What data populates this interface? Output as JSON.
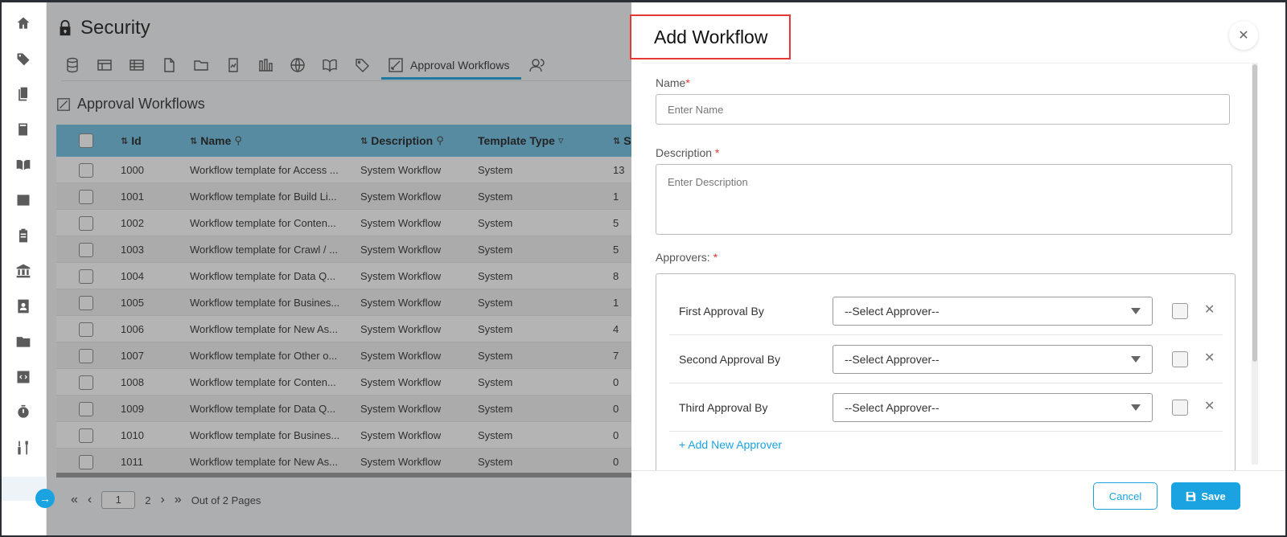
{
  "page": {
    "title": "Security"
  },
  "tabs": [
    {
      "icon": "database-icon",
      "label": ""
    },
    {
      "icon": "table-icon",
      "label": ""
    },
    {
      "icon": "grid-icon",
      "label": ""
    },
    {
      "icon": "file-icon",
      "label": ""
    },
    {
      "icon": "folder-icon",
      "label": ""
    },
    {
      "icon": "chart-file-icon",
      "label": ""
    },
    {
      "icon": "bar-chart-icon",
      "label": ""
    },
    {
      "icon": "globe-icon",
      "label": ""
    },
    {
      "icon": "book-open-icon",
      "label": ""
    },
    {
      "icon": "tag-icon",
      "label": ""
    },
    {
      "icon": "workflow-icon",
      "label": "Approval Workflows"
    },
    {
      "icon": "users-icon",
      "label": ""
    }
  ],
  "section": {
    "title": "Approval Workflows"
  },
  "table": {
    "columns": [
      "Id",
      "Name",
      "Description",
      "Template Type",
      "S"
    ],
    "rows": [
      {
        "id": "1000",
        "name": "Workflow template for Access ...",
        "description": "System Workflow",
        "type": "System",
        "count": "13"
      },
      {
        "id": "1001",
        "name": "Workflow template for Build Li...",
        "description": "System Workflow",
        "type": "System",
        "count": "1"
      },
      {
        "id": "1002",
        "name": "Workflow template for Conten...",
        "description": "System Workflow",
        "type": "System",
        "count": "5"
      },
      {
        "id": "1003",
        "name": "Workflow template for Crawl / ...",
        "description": "System Workflow",
        "type": "System",
        "count": "5"
      },
      {
        "id": "1004",
        "name": "Workflow template for Data Q...",
        "description": "System Workflow",
        "type": "System",
        "count": "8"
      },
      {
        "id": "1005",
        "name": "Workflow template for Busines...",
        "description": "System Workflow",
        "type": "System",
        "count": "1"
      },
      {
        "id": "1006",
        "name": "Workflow template for New As...",
        "description": "System Workflow",
        "type": "System",
        "count": "4"
      },
      {
        "id": "1007",
        "name": "Workflow template for Other o...",
        "description": "System Workflow",
        "type": "System",
        "count": "7"
      },
      {
        "id": "1008",
        "name": "Workflow template for Conten...",
        "description": "System Workflow",
        "type": "System",
        "count": "0"
      },
      {
        "id": "1009",
        "name": "Workflow template for Data Q...",
        "description": "System Workflow",
        "type": "System",
        "count": "0"
      },
      {
        "id": "1010",
        "name": "Workflow template for Busines...",
        "description": "System Workflow",
        "type": "System",
        "count": "0"
      },
      {
        "id": "1011",
        "name": "Workflow template for New As...",
        "description": "System Workflow",
        "type": "System",
        "count": "0"
      }
    ]
  },
  "pager": {
    "current": "1",
    "next_page": "2",
    "summary": "Out of 2 Pages"
  },
  "modal": {
    "title": "Add Workflow",
    "name_label": "Name",
    "name_placeholder": "Enter Name",
    "description_label": "Description",
    "description_placeholder": "Enter Description",
    "approvers_label": "Approvers:",
    "required_mark": "*",
    "approvers": [
      {
        "label": "First Approval By",
        "value": "--Select Approver--"
      },
      {
        "label": "Second Approval By",
        "value": "--Select Approver--"
      },
      {
        "label": "Third Approval By",
        "value": "--Select Approver--"
      }
    ],
    "add_approver": "+ Add New Approver",
    "cancel": "Cancel",
    "save": "Save"
  },
  "colors": {
    "accent": "#1aa3e0",
    "header_row": "#6fc0e3",
    "highlight": "#e53935"
  }
}
